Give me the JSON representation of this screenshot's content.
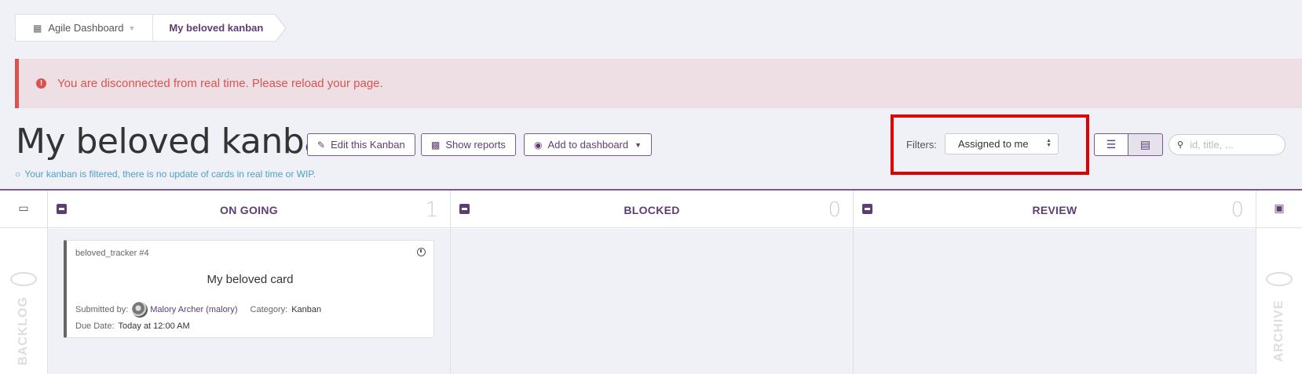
{
  "breadcrumb": {
    "dashboard_label": "Agile Dashboard",
    "current_label": "My beloved kanban"
  },
  "alert": {
    "message": "You are disconnected from real time. Please reload your page."
  },
  "header": {
    "title": "My beloved kanban",
    "edit_label": "Edit this Kanban",
    "reports_label": "Show reports",
    "dashboard_label": "Add to dashboard",
    "filtered_notice": "Your kanban is filtered, there is no update of cards in real time or WIP."
  },
  "filter": {
    "label": "Filters:",
    "selected": "Assigned to me"
  },
  "search": {
    "placeholder": "id, title, ..."
  },
  "board": {
    "backlog": {
      "label": "BACKLOG"
    },
    "archive": {
      "label": "ARCHIVE"
    },
    "columns": [
      {
        "label": "ON GOING",
        "count": "1"
      },
      {
        "label": "BLOCKED",
        "count": "0"
      },
      {
        "label": "REVIEW",
        "count": "0"
      }
    ]
  },
  "card": {
    "id": "beloved_tracker #4",
    "title": "My beloved card",
    "submitted_by_label": "Submitted by:",
    "submitted_by": "Malory Archer (malory)",
    "category_label": "Category:",
    "category": "Kanban",
    "due_label": "Due Date:",
    "due": "Today at 12:00 AM"
  },
  "colors": {
    "accent": "#5e3d73",
    "danger": "#d9534f",
    "info": "#4fa0c7",
    "highlight": "#e00000"
  }
}
